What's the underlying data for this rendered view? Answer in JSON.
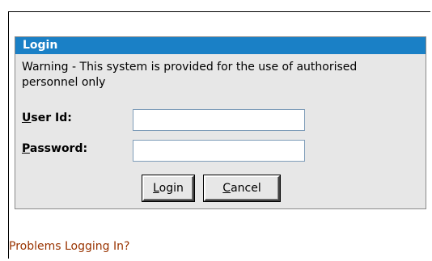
{
  "panel": {
    "title": "Login",
    "warning": "Warning - This system is provided for the use of authorised personnel only"
  },
  "fields": {
    "user_id": {
      "label_access_key": "U",
      "label_rest": "ser Id:",
      "value": ""
    },
    "password": {
      "label_access_key": "P",
      "label_rest": "assword:",
      "value": ""
    }
  },
  "buttons": {
    "login": {
      "access_key": "L",
      "rest": "ogin"
    },
    "cancel": {
      "access_key": "C",
      "rest": "ancel"
    }
  },
  "links": {
    "problems": "Problems Logging In?"
  },
  "colors": {
    "header_bg": "#1a80c6",
    "panel_bg": "#e7e7e7",
    "link": "#993300"
  }
}
